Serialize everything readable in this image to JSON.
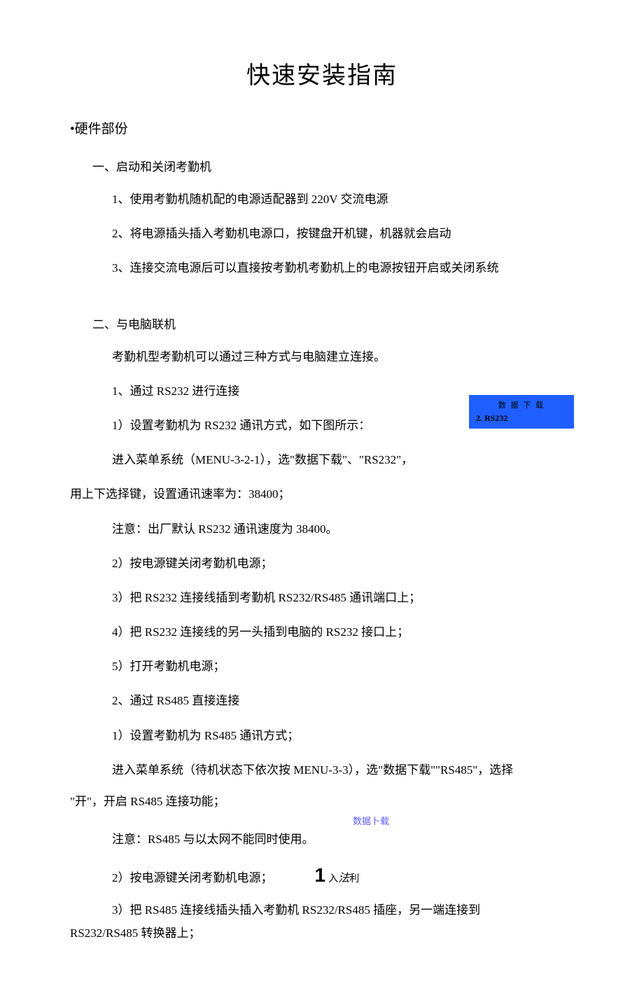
{
  "title": "快速安装指南",
  "section_hardware": "•硬件部份",
  "sec1_title": "一、启动和关闭考勤机",
  "sec1_items": [
    "1、使用考勤机随机配的电源适配器到 220V 交流电源",
    "2、将电源插头插入考勤机电源口，按键盘开机键，机器就会启动",
    "3、连接交流电源后可以直接按考勤机考勤机上的电源按钮开启或关闭系统"
  ],
  "sec2_title": "二、与电脑联机",
  "sec2_intro": "考勤机型考勤机可以通过三种方式与电脑建立连接。",
  "sec2_1_title": "1、通过 RS232 进行连接",
  "sec2_1_step1": "1）设置考勤机为 RS232 通讯方式，如下图所示：",
  "sec2_1_menu": "进入菜单系统（MENU-3-2-1），选\"数据下载\"、\"RS232\"，",
  "sec2_1_speed": "用上下选择键，设置通讯速率为：38400；",
  "sec2_1_note": "注意：出厂默认 RS232 通讯速度为 38400。",
  "sec2_1_steps": [
    "2）按电源键关闭考勤机电源；",
    "3）把 RS232 连接线插到考勤机 RS232/RS485 通讯端口上；",
    "4）把 RS232 连接线的另一头插到电脑的 RS232 接口上；",
    "5）打开考勤机电源；"
  ],
  "sec2_2_title": "2、通过 RS485 直接连接",
  "sec2_2_step1": "1）设置考勤机为 RS485 通讯方式；",
  "sec2_2_menu": "进入菜单系统（待机状态下依次按 MENU-3-3），选\"数据下载\"\"RS485\"，选择",
  "sec2_2_open": "\"开\"，开启 RS485 连接功能；",
  "blue_label": "数据卜载",
  "sec2_2_note": "注意：RS485 与以太网不能同时使用。",
  "sec2_2_step2": "2）按电源键关闭考勤机电源；",
  "inline_big": "1",
  "inline_small": "入法利",
  "sec2_2_step3": "3）把 RS485 连接线插头插入考勤机 RS232/RS485 插座，另一端连接到",
  "sec2_2_step3b": "RS232/RS485 转换器上；",
  "floatbox": {
    "line1": "数 据 下 载",
    "line2": "2. RS232"
  }
}
